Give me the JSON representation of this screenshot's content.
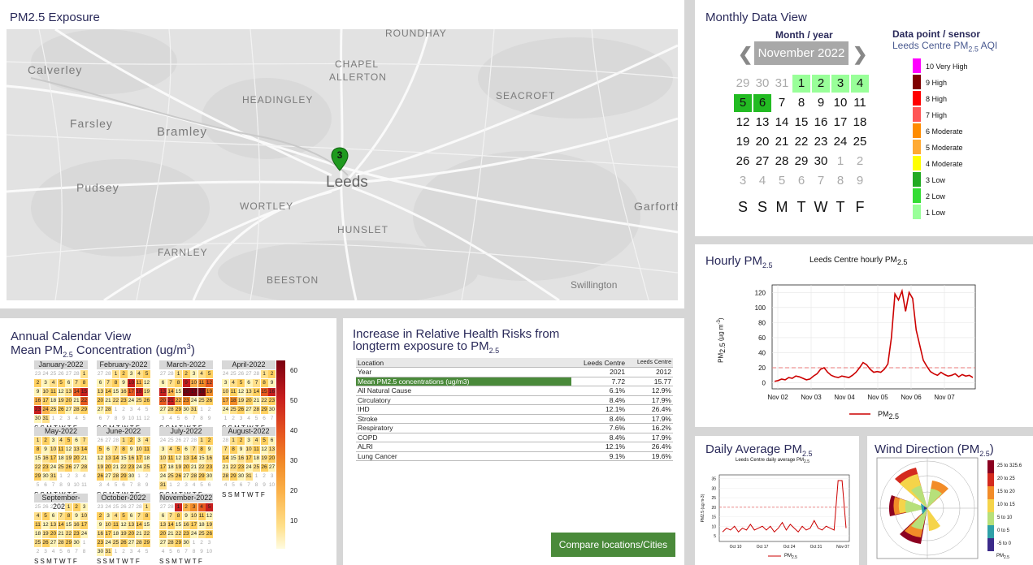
{
  "map_panel": {
    "title": "PM2.5 Exposure",
    "labels": [
      "ROUNDHAY",
      "Calverley",
      "CHAPEL",
      "ALLERTON",
      "HEADINGLEY",
      "SEACROFT",
      "Farsley",
      "Bramley",
      "Leeds",
      "Pudsey",
      "WORTLEY",
      "Garforth",
      "HUNSLET",
      "FARNLEY",
      "BEESTON",
      "Swillington"
    ],
    "marker": "3"
  },
  "monthly": {
    "title": "Monthly Data View",
    "month_label": "Month / year",
    "month_value": "November 2022",
    "sensor_label": "Data point / sensor",
    "sensor_value": "Leeds Centre PM",
    "sensor_sub": "2.5",
    "sensor_suffix": " AQI",
    "days": [
      [
        "29",
        "30",
        "31",
        "1",
        "2",
        "3",
        "4"
      ],
      [
        "5",
        "6",
        "7",
        "8",
        "9",
        "10",
        "11"
      ],
      [
        "12",
        "13",
        "14",
        "15",
        "16",
        "17",
        "18"
      ],
      [
        "19",
        "20",
        "21",
        "22",
        "23",
        "24",
        "25"
      ],
      [
        "26",
        "27",
        "28",
        "29",
        "30",
        "1",
        "2"
      ],
      [
        "3",
        "4",
        "5",
        "6",
        "7",
        "8",
        "9"
      ]
    ],
    "dow": [
      "S",
      "S",
      "M",
      "T",
      "W",
      "T",
      "F"
    ],
    "legend": [
      {
        "label": "10 Very High",
        "color": "#ff00ff"
      },
      {
        "label": "9 High",
        "color": "#7f0000"
      },
      {
        "label": "8 High",
        "color": "#ff0000"
      },
      {
        "label": "7 High",
        "color": "#ff5555"
      },
      {
        "label": "6 Moderate",
        "color": "#ff8c00"
      },
      {
        "label": "5 Moderate",
        "color": "#ffaa33"
      },
      {
        "label": "4 Moderate",
        "color": "#ffff00"
      },
      {
        "label": "3 Low",
        "color": "#22aa22"
      },
      {
        "label": "2 Low",
        "color": "#33dd33"
      },
      {
        "label": "1 Low",
        "color": "#99ff99"
      }
    ]
  },
  "annual": {
    "title": "Annual Calendar View",
    "subtitle_a": "Mean PM",
    "subtitle_sub": "2.5",
    "subtitle_b": " Concentration (ug/m",
    "subtitle_sup": "3",
    "subtitle_c": ")",
    "months": [
      "January-2022",
      "February-2022",
      "March-2022",
      "April-2022",
      "May-2022",
      "June-2022",
      "July-2022",
      "August-2022",
      "September-2022",
      "October-2022",
      "November-2022"
    ],
    "dow": "SSMTWTF",
    "scale_ticks": [
      "60",
      "50",
      "40",
      "30",
      "20",
      "10"
    ]
  },
  "health": {
    "title_a": "Increase in Relative Health Risks from",
    "title_b": "longterm exposure to PM",
    "title_sub": "2.5",
    "table": {
      "head": [
        "Location",
        "Leeds Centre",
        "Leeds Centre"
      ],
      "rows": [
        [
          "Year",
          "2021",
          "2012"
        ],
        [
          "Mean PM2.5 concentrations (ug/m3)",
          "7.72",
          "15.77"
        ],
        [
          "All Natural Cause",
          "6.1%",
          "12.9%"
        ],
        [
          "Circulatory",
          "8.4%",
          "17.9%"
        ],
        [
          "IHD",
          "12.1%",
          "26.4%"
        ],
        [
          "Stroke",
          "8.4%",
          "17.9%"
        ],
        [
          "Respiratory",
          "7.6%",
          "16.2%"
        ],
        [
          "COPD",
          "8.4%",
          "17.9%"
        ],
        [
          "ALRI",
          "12.1%",
          "26.4%"
        ],
        [
          "Lung Cancer",
          "9.1%",
          "19.6%"
        ]
      ]
    },
    "button": "Compare locations/Cities"
  },
  "hourly": {
    "title": "Hourly PM",
    "title_sub": "2.5",
    "chart_title": "Leeds Centre hourly PM",
    "chart_title_sub": "2.5",
    "legend": "PM",
    "legend_sub": "2.5",
    "ylabel": "PM",
    "ylabel_sub": "2.5",
    "ylabel_tail": " (µg m",
    "ylabel_sup": "-3",
    "ylabel_end": ")"
  },
  "daily": {
    "title": "Daily Average PM",
    "title_sub": "2.5",
    "chart_title": "Leeds Centre daily average PM",
    "chart_title_sub": "2.5",
    "legend": "PM",
    "legend_sub": "2.5"
  },
  "wind": {
    "title": "Wind Direction (PM",
    "title_sub": "2.5",
    "title_end": ")",
    "legend": [
      "25 to 325.6",
      "20 to 25",
      "15 to 20",
      "10 to 15",
      "5 to 10",
      "0 to 5",
      "-5 to 0"
    ],
    "legend_colors": [
      "#8b0020",
      "#d42a1e",
      "#f28c28",
      "#f5d44a",
      "#b7e07a",
      "#2fa0a8",
      "#3b2a8a"
    ],
    "caption": "PM",
    "caption_sub": "2.5"
  },
  "chart_data": [
    {
      "type": "line",
      "title": "Leeds Centre hourly PM2.5",
      "xlabel": "",
      "ylabel": "PM2.5 (ug m-3)",
      "x_ticks": [
        "Nov 02",
        "Nov 03",
        "Nov 04",
        "Nov 05",
        "Nov 06",
        "Nov 07"
      ],
      "y_ticks": [
        0,
        20,
        40,
        60,
        80,
        100,
        120
      ],
      "ylim": [
        -8,
        130
      ],
      "reference_line": 20,
      "series": [
        {
          "name": "PM2.5",
          "values": [
            2,
            3,
            5,
            4,
            7,
            6,
            9,
            8,
            6,
            4,
            5,
            9,
            12,
            18,
            20,
            14,
            10,
            8,
            7,
            9,
            8,
            7,
            10,
            14,
            20,
            27,
            24,
            18,
            14,
            15,
            14,
            18,
            25,
            60,
            118,
            110,
            122,
            95,
            120,
            112,
            70,
            50,
            30,
            22,
            15,
            12,
            10,
            14,
            11,
            9,
            10,
            12,
            8,
            11,
            9,
            10,
            7
          ]
        }
      ]
    },
    {
      "type": "line",
      "title": "Leeds Centre daily average PM2.5",
      "y_ticks": [
        5,
        10,
        15,
        20,
        25,
        30,
        35
      ],
      "x_ticks": [
        "Oct 10",
        "Oct 17",
        "Oct 24",
        "Oct 31",
        "Nov 07"
      ],
      "reference_line": 20,
      "series": [
        {
          "name": "PM2.5",
          "values": [
            7,
            9,
            8,
            10,
            7,
            9,
            8,
            11,
            8,
            9,
            10,
            8,
            10,
            7,
            9,
            12,
            8,
            11,
            9,
            7,
            10,
            8,
            9,
            13,
            9,
            8,
            10,
            9,
            8,
            34,
            34,
            9
          ]
        }
      ]
    }
  ]
}
